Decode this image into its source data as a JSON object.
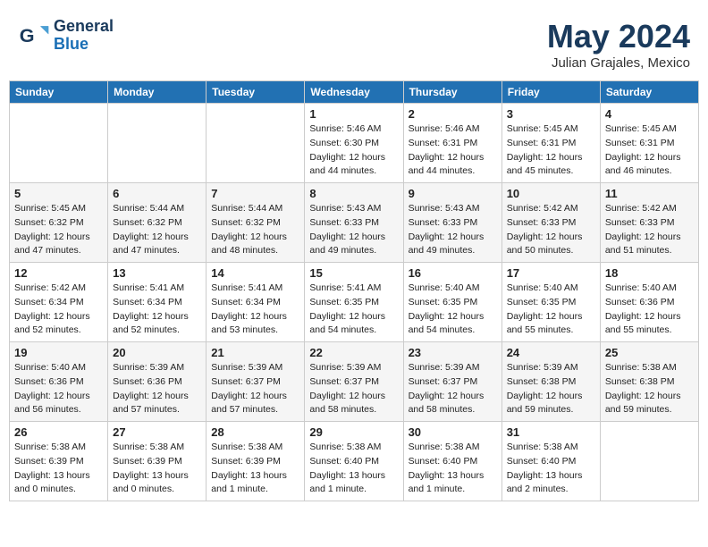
{
  "header": {
    "logo_general": "General",
    "logo_blue": "Blue",
    "month_title": "May 2024",
    "subtitle": "Julian Grajales, Mexico"
  },
  "weekdays": [
    "Sunday",
    "Monday",
    "Tuesday",
    "Wednesday",
    "Thursday",
    "Friday",
    "Saturday"
  ],
  "weeks": [
    [
      {
        "day": "",
        "info": ""
      },
      {
        "day": "",
        "info": ""
      },
      {
        "day": "",
        "info": ""
      },
      {
        "day": "1",
        "info": "Sunrise: 5:46 AM\nSunset: 6:30 PM\nDaylight: 12 hours\nand 44 minutes."
      },
      {
        "day": "2",
        "info": "Sunrise: 5:46 AM\nSunset: 6:31 PM\nDaylight: 12 hours\nand 44 minutes."
      },
      {
        "day": "3",
        "info": "Sunrise: 5:45 AM\nSunset: 6:31 PM\nDaylight: 12 hours\nand 45 minutes."
      },
      {
        "day": "4",
        "info": "Sunrise: 5:45 AM\nSunset: 6:31 PM\nDaylight: 12 hours\nand 46 minutes."
      }
    ],
    [
      {
        "day": "5",
        "info": "Sunrise: 5:45 AM\nSunset: 6:32 PM\nDaylight: 12 hours\nand 47 minutes."
      },
      {
        "day": "6",
        "info": "Sunrise: 5:44 AM\nSunset: 6:32 PM\nDaylight: 12 hours\nand 47 minutes."
      },
      {
        "day": "7",
        "info": "Sunrise: 5:44 AM\nSunset: 6:32 PM\nDaylight: 12 hours\nand 48 minutes."
      },
      {
        "day": "8",
        "info": "Sunrise: 5:43 AM\nSunset: 6:33 PM\nDaylight: 12 hours\nand 49 minutes."
      },
      {
        "day": "9",
        "info": "Sunrise: 5:43 AM\nSunset: 6:33 PM\nDaylight: 12 hours\nand 49 minutes."
      },
      {
        "day": "10",
        "info": "Sunrise: 5:42 AM\nSunset: 6:33 PM\nDaylight: 12 hours\nand 50 minutes."
      },
      {
        "day": "11",
        "info": "Sunrise: 5:42 AM\nSunset: 6:33 PM\nDaylight: 12 hours\nand 51 minutes."
      }
    ],
    [
      {
        "day": "12",
        "info": "Sunrise: 5:42 AM\nSunset: 6:34 PM\nDaylight: 12 hours\nand 52 minutes."
      },
      {
        "day": "13",
        "info": "Sunrise: 5:41 AM\nSunset: 6:34 PM\nDaylight: 12 hours\nand 52 minutes."
      },
      {
        "day": "14",
        "info": "Sunrise: 5:41 AM\nSunset: 6:34 PM\nDaylight: 12 hours\nand 53 minutes."
      },
      {
        "day": "15",
        "info": "Sunrise: 5:41 AM\nSunset: 6:35 PM\nDaylight: 12 hours\nand 54 minutes."
      },
      {
        "day": "16",
        "info": "Sunrise: 5:40 AM\nSunset: 6:35 PM\nDaylight: 12 hours\nand 54 minutes."
      },
      {
        "day": "17",
        "info": "Sunrise: 5:40 AM\nSunset: 6:35 PM\nDaylight: 12 hours\nand 55 minutes."
      },
      {
        "day": "18",
        "info": "Sunrise: 5:40 AM\nSunset: 6:36 PM\nDaylight: 12 hours\nand 55 minutes."
      }
    ],
    [
      {
        "day": "19",
        "info": "Sunrise: 5:40 AM\nSunset: 6:36 PM\nDaylight: 12 hours\nand 56 minutes."
      },
      {
        "day": "20",
        "info": "Sunrise: 5:39 AM\nSunset: 6:36 PM\nDaylight: 12 hours\nand 57 minutes."
      },
      {
        "day": "21",
        "info": "Sunrise: 5:39 AM\nSunset: 6:37 PM\nDaylight: 12 hours\nand 57 minutes."
      },
      {
        "day": "22",
        "info": "Sunrise: 5:39 AM\nSunset: 6:37 PM\nDaylight: 12 hours\nand 58 minutes."
      },
      {
        "day": "23",
        "info": "Sunrise: 5:39 AM\nSunset: 6:37 PM\nDaylight: 12 hours\nand 58 minutes."
      },
      {
        "day": "24",
        "info": "Sunrise: 5:39 AM\nSunset: 6:38 PM\nDaylight: 12 hours\nand 59 minutes."
      },
      {
        "day": "25",
        "info": "Sunrise: 5:38 AM\nSunset: 6:38 PM\nDaylight: 12 hours\nand 59 minutes."
      }
    ],
    [
      {
        "day": "26",
        "info": "Sunrise: 5:38 AM\nSunset: 6:39 PM\nDaylight: 13 hours\nand 0 minutes."
      },
      {
        "day": "27",
        "info": "Sunrise: 5:38 AM\nSunset: 6:39 PM\nDaylight: 13 hours\nand 0 minutes."
      },
      {
        "day": "28",
        "info": "Sunrise: 5:38 AM\nSunset: 6:39 PM\nDaylight: 13 hours\nand 1 minute."
      },
      {
        "day": "29",
        "info": "Sunrise: 5:38 AM\nSunset: 6:40 PM\nDaylight: 13 hours\nand 1 minute."
      },
      {
        "day": "30",
        "info": "Sunrise: 5:38 AM\nSunset: 6:40 PM\nDaylight: 13 hours\nand 1 minute."
      },
      {
        "day": "31",
        "info": "Sunrise: 5:38 AM\nSunset: 6:40 PM\nDaylight: 13 hours\nand 2 minutes."
      },
      {
        "day": "",
        "info": ""
      }
    ]
  ]
}
